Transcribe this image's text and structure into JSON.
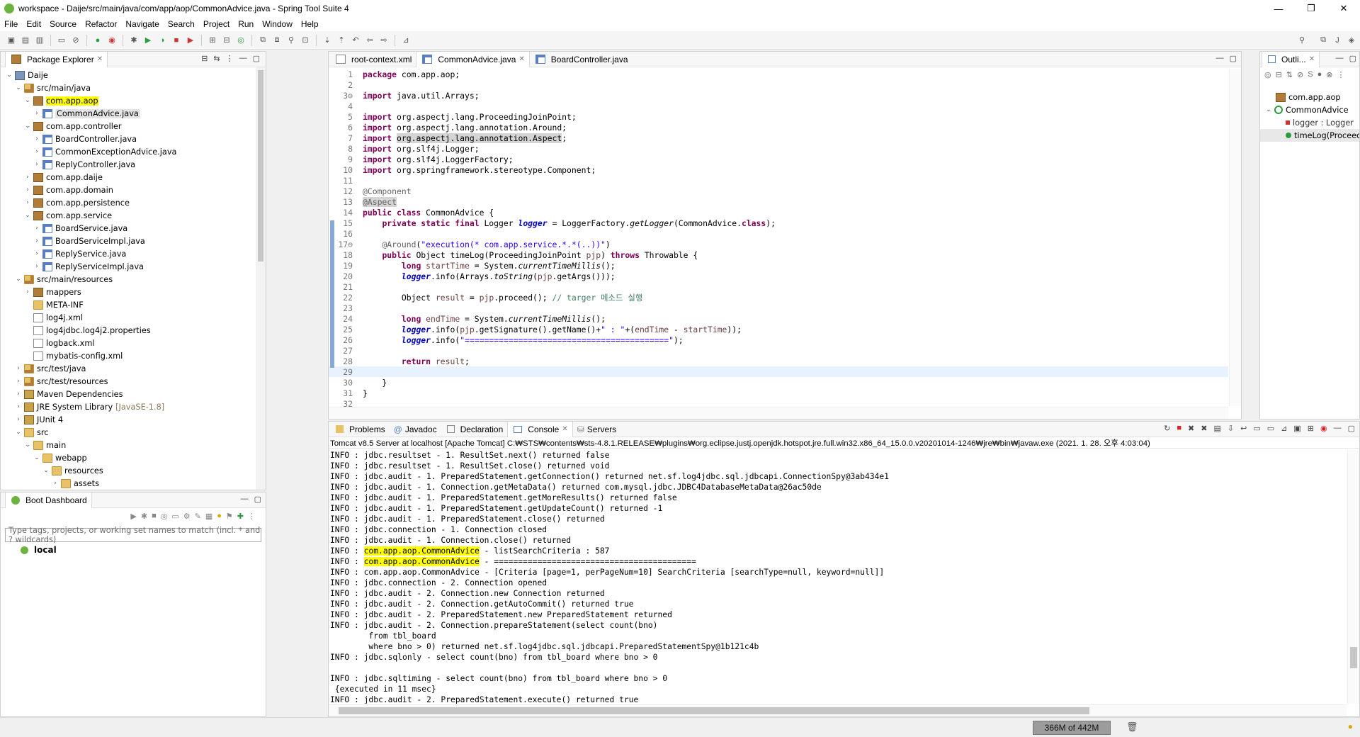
{
  "window": {
    "title": "workspace - Daije/src/main/java/com/app/aop/CommonAdvice.java - Spring Tool Suite 4",
    "controls": [
      "—",
      "❐",
      "✕"
    ]
  },
  "menu": [
    "File",
    "Edit",
    "Source",
    "Refactor",
    "Navigate",
    "Search",
    "Project",
    "Run",
    "Window",
    "Help"
  ],
  "package_explorer": {
    "title": "Package Explorer",
    "tree": [
      {
        "indent": 0,
        "tw": "⌄",
        "icon": "proj",
        "label": "Daije"
      },
      {
        "indent": 1,
        "tw": "⌄",
        "icon": "src",
        "label": "src/main/java"
      },
      {
        "indent": 2,
        "tw": "⌄",
        "icon": "pkg",
        "label": "com.app.aop",
        "hl": "yellow"
      },
      {
        "indent": 3,
        "tw": "›",
        "icon": "java",
        "label": "CommonAdvice.java",
        "hl": "sel"
      },
      {
        "indent": 2,
        "tw": "⌄",
        "icon": "pkg",
        "label": "com.app.controller"
      },
      {
        "indent": 3,
        "tw": "›",
        "icon": "java",
        "label": "BoardController.java"
      },
      {
        "indent": 3,
        "tw": "›",
        "icon": "java",
        "label": "CommonExceptionAdvice.java"
      },
      {
        "indent": 3,
        "tw": "›",
        "icon": "java",
        "label": "ReplyController.java"
      },
      {
        "indent": 2,
        "tw": "›",
        "icon": "pkg",
        "label": "com.app.daije"
      },
      {
        "indent": 2,
        "tw": "›",
        "icon": "pkg",
        "label": "com.app.domain"
      },
      {
        "indent": 2,
        "tw": "›",
        "icon": "pkg",
        "label": "com.app.persistence"
      },
      {
        "indent": 2,
        "tw": "⌄",
        "icon": "pkg",
        "label": "com.app.service"
      },
      {
        "indent": 3,
        "tw": "›",
        "icon": "java",
        "label": "BoardService.java"
      },
      {
        "indent": 3,
        "tw": "›",
        "icon": "java",
        "label": "BoardServiceImpl.java"
      },
      {
        "indent": 3,
        "tw": "›",
        "icon": "java",
        "label": "ReplyService.java"
      },
      {
        "indent": 3,
        "tw": "›",
        "icon": "java",
        "label": "ReplyServiceImpl.java"
      },
      {
        "indent": 1,
        "tw": "⌄",
        "icon": "src",
        "label": "src/main/resources"
      },
      {
        "indent": 2,
        "tw": "›",
        "icon": "pkg",
        "label": "mappers"
      },
      {
        "indent": 2,
        "tw": "",
        "icon": "folder",
        "label": "META-INF"
      },
      {
        "indent": 2,
        "tw": "",
        "icon": "xml",
        "label": "log4j.xml"
      },
      {
        "indent": 2,
        "tw": "",
        "icon": "xml",
        "label": "log4jdbc.log4j2.properties"
      },
      {
        "indent": 2,
        "tw": "",
        "icon": "xml",
        "label": "logback.xml"
      },
      {
        "indent": 2,
        "tw": "",
        "icon": "xml",
        "label": "mybatis-config.xml"
      },
      {
        "indent": 1,
        "tw": "›",
        "icon": "src",
        "label": "src/test/java"
      },
      {
        "indent": 1,
        "tw": "›",
        "icon": "src",
        "label": "src/test/resources"
      },
      {
        "indent": 1,
        "tw": "›",
        "icon": "lib",
        "label": "Maven Dependencies"
      },
      {
        "indent": 1,
        "tw": "›",
        "icon": "lib",
        "label": "JRE System Library",
        "suffix": "[JavaSE-1.8]"
      },
      {
        "indent": 1,
        "tw": "›",
        "icon": "lib",
        "label": "JUnit 4"
      },
      {
        "indent": 1,
        "tw": "⌄",
        "icon": "folder",
        "label": "src"
      },
      {
        "indent": 2,
        "tw": "⌄",
        "icon": "folder",
        "label": "main"
      },
      {
        "indent": 3,
        "tw": "⌄",
        "icon": "folder",
        "label": "webapp"
      },
      {
        "indent": 4,
        "tw": "⌄",
        "icon": "folder",
        "label": "resources"
      },
      {
        "indent": 5,
        "tw": "›",
        "icon": "folder",
        "label": "assets"
      }
    ]
  },
  "boot_dashboard": {
    "title": "Boot Dashboard",
    "filter_placeholder": "Type tags, projects, or working set names to match (incl. * and ? wildcards)",
    "local_label": "local"
  },
  "editor": {
    "tabs": [
      {
        "label": "root-context.xml",
        "active": false
      },
      {
        "label": "CommonAdvice.java",
        "active": true
      },
      {
        "label": "BoardController.java",
        "active": false
      }
    ],
    "lines": [
      {
        "n": "1",
        "html": "<span class='kw'>package</span> com.app.aop;"
      },
      {
        "n": "2",
        "html": ""
      },
      {
        "n": "3⊖",
        "html": "<span class='kw'>import</span> java.util.Arrays;"
      },
      {
        "n": "4",
        "html": ""
      },
      {
        "n": "5",
        "html": "<span class='kw'>import</span> org.aspectj.lang.ProceedingJoinPoint;"
      },
      {
        "n": "6",
        "html": "<span class='kw'>import</span> org.aspectj.lang.annotation.Around;"
      },
      {
        "n": "7",
        "html": "<span class='kw'>import</span> <span class='occur'>org.aspectj.lang.annotation.Aspect</span>;"
      },
      {
        "n": "8",
        "html": "<span class='kw'>import</span> org.slf4j.Logger;"
      },
      {
        "n": "9",
        "html": "<span class='kw'>import</span> org.slf4j.LoggerFactory;"
      },
      {
        "n": "10",
        "html": "<span class='kw'>import</span> org.springframework.stereotype.Component;"
      },
      {
        "n": "11",
        "html": ""
      },
      {
        "n": "12",
        "html": "<span class='ann'>@Component</span>"
      },
      {
        "n": "13",
        "html": "<span class='ann occur'>@Aspect</span>"
      },
      {
        "n": "14",
        "html": "<span class='kw'>public class</span> CommonAdvice {"
      },
      {
        "n": "15",
        "html": "    <span class='kw'>private static final</span> Logger <span class='fld'>logger</span> = LoggerFactory.<span class='ital'>getLogger</span>(CommonAdvice.<span class='kw'>class</span>);"
      },
      {
        "n": "16",
        "html": ""
      },
      {
        "n": "17⊖",
        "html": "    <span class='ann'>@Around</span>(<span class='str'>\"execution(* com.app.service.*.*(..))\"</span>)"
      },
      {
        "n": "18",
        "html": "    <span class='kw'>public</span> Object timeLog(ProceedingJoinPoint <span class='loc'>pjp</span>) <span class='kw'>throws</span> Throwable {"
      },
      {
        "n": "19",
        "html": "        <span class='kw'>long</span> <span class='loc'>startTime</span> = System.<span class='ital'>currentTimeMillis</span>();"
      },
      {
        "n": "20",
        "html": "        <span class='fld'>logger</span>.info(Arrays.<span class='ital'>toString</span>(<span class='loc'>pjp</span>.getArgs()));"
      },
      {
        "n": "21",
        "html": ""
      },
      {
        "n": "22",
        "html": "        Object <span class='loc'>result</span> = <span class='loc'>pjp</span>.proceed(); <span class='cmt'>// targer 메소드 실행</span>"
      },
      {
        "n": "23",
        "html": ""
      },
      {
        "n": "24",
        "html": "        <span class='kw'>long</span> <span class='loc'>endTime</span> = System.<span class='ital'>currentTimeMillis</span>();"
      },
      {
        "n": "25",
        "html": "        <span class='fld'>logger</span>.info(<span class='loc'>pjp</span>.getSignature().getName()+<span class='str'>\" : \"</span>+(<span class='loc'>endTime</span> - <span class='loc'>startTime</span>));"
      },
      {
        "n": "26",
        "html": "        <span class='fld'>logger</span>.info(<span class='str'>\"==========================================\"</span>);"
      },
      {
        "n": "27",
        "html": ""
      },
      {
        "n": "28",
        "html": "        <span class='kw'>return</span> <span class='loc'>result</span>;"
      },
      {
        "n": "29",
        "html": "",
        "current": true
      },
      {
        "n": "30",
        "html": "    }"
      },
      {
        "n": "31",
        "html": "}"
      },
      {
        "n": "32",
        "html": ""
      }
    ]
  },
  "outline": {
    "title": "Outli...",
    "items": [
      {
        "label": "com.app.aop"
      },
      {
        "label": "CommonAdvice"
      },
      {
        "label": "logger : Logger"
      },
      {
        "label": "timeLog(ProceedingJoinPoint)"
      }
    ]
  },
  "bottom_tabs": [
    {
      "label": "Problems",
      "active": false
    },
    {
      "label": "Javadoc",
      "active": false
    },
    {
      "label": "Declaration",
      "active": false
    },
    {
      "label": "Console",
      "active": true
    },
    {
      "label": "Servers",
      "active": false
    }
  ],
  "console": {
    "header": "Tomcat v8.5 Server at localhost [Apache Tomcat] C:₩STS₩contents₩sts-4.8.1.RELEASE₩plugins₩org.eclipse.justj.openjdk.hotspot.jre.full.win32.x86_64_15.0.0.v20201014-1246₩jre₩bin₩javaw.exe  (2021. 1. 28. 오후 4:03:04)",
    "lines": [
      {
        "t": "INFO : jdbc.resultset - 1. ResultSet.next() returned false"
      },
      {
        "t": "INFO : jdbc.resultset - 1. ResultSet.close() returned void"
      },
      {
        "t": "INFO : jdbc.audit - 1. PreparedStatement.getConnection() returned net.sf.log4jdbc.sql.jdbcapi.ConnectionSpy@3ab434e1"
      },
      {
        "t": "INFO : jdbc.audit - 1. Connection.getMetaData() returned com.mysql.jdbc.JDBC4DatabaseMetaData@26ac50de"
      },
      {
        "t": "INFO : jdbc.audit - 1. PreparedStatement.getMoreResults() returned false"
      },
      {
        "t": "INFO : jdbc.audit - 1. PreparedStatement.getUpdateCount() returned -1"
      },
      {
        "t": "INFO : jdbc.audit - 1. PreparedStatement.close() returned"
      },
      {
        "t": "INFO : jdbc.connection - 1. Connection closed"
      },
      {
        "t": "INFO : jdbc.audit - 1. Connection.close() returned"
      },
      {
        "pre": "INFO : ",
        "hl": "com.app.aop.CommonAdvice",
        "t": " - listSearchCriteria : 587"
      },
      {
        "pre": "INFO : ",
        "hl": "com.app.aop.CommonAdvice",
        "t": " - =========================================="
      },
      {
        "t": "INFO : com.app.aop.CommonAdvice - [Criteria [page=1, perPageNum=10] SearchCriteria [searchType=null, keyword=null]]"
      },
      {
        "t": "INFO : jdbc.connection - 2. Connection opened"
      },
      {
        "t": "INFO : jdbc.audit - 2. Connection.new Connection returned"
      },
      {
        "t": "INFO : jdbc.audit - 2. Connection.getAutoCommit() returned true"
      },
      {
        "t": "INFO : jdbc.audit - 2. PreparedStatement.new PreparedStatement returned"
      },
      {
        "t": "INFO : jdbc.audit - 2. Connection.prepareStatement(select count(bno)"
      },
      {
        "t": "        from tbl_board"
      },
      {
        "t": "        where bno > 0) returned net.sf.log4jdbc.sql.jdbcapi.PreparedStatementSpy@1b121c4b"
      },
      {
        "t": "INFO : jdbc.sqlonly - select count(bno) from tbl_board where bno > 0"
      },
      {
        "t": ""
      },
      {
        "t": "INFO : jdbc.sqltiming - select count(bno) from tbl_board where bno > 0"
      },
      {
        "t": " {executed in 11 msec}"
      },
      {
        "t": "INFO : jdbc.audit - 2. PreparedStatement.execute() returned true"
      }
    ]
  },
  "status": {
    "heap": "366M of 442M"
  }
}
